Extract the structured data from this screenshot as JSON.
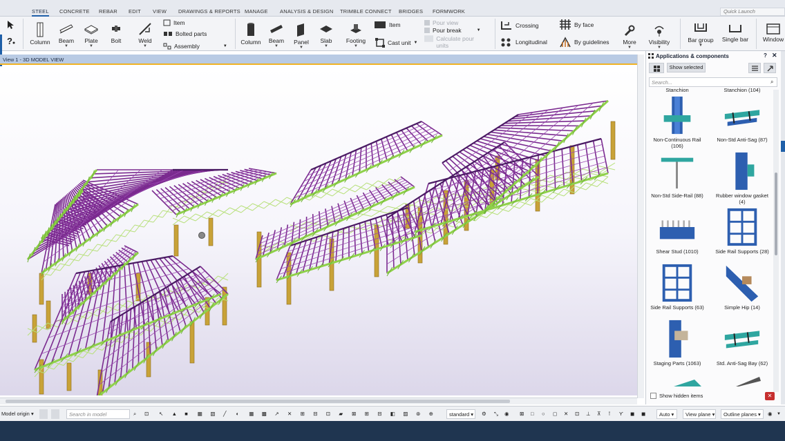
{
  "tabs": [
    "STEEL",
    "CONCRETE",
    "REBAR",
    "EDIT",
    "VIEW",
    "DRAWINGS & REPORTS",
    "MANAGE",
    "ANALYSIS & DESIGN",
    "TRIMBLE CONNECT",
    "BRIDGES",
    "FORMWORK"
  ],
  "quick_launch": "Quick Launch",
  "ribbon": {
    "steel": {
      "column": "Column",
      "beam": "Beam",
      "plate": "Plate",
      "bolt": "Bolt",
      "weld": "Weld",
      "item": "Item",
      "bolted_parts": "Bolted parts",
      "assembly": "Assembly"
    },
    "concrete": {
      "column": "Column",
      "beam": "Beam",
      "panel": "Panel",
      "slab": "Slab",
      "footing": "Footing",
      "item": "Item",
      "cast_unit": "Cast unit",
      "pour_view": "Pour view",
      "pour_break": "Pour break",
      "calculate_pour_units": "Calculate pour units"
    },
    "rebar": {
      "crossing": "Crossing",
      "longitudinal": "Longitudinal",
      "by_face": "By face",
      "by_guidelines": "By guidelines",
      "more": "More",
      "visibility": "Visibility",
      "bar_group": "Bar group",
      "single_bar": "Single bar",
      "window": "Window"
    }
  },
  "view": {
    "title": "View 1 - 3D MODEL VIEW"
  },
  "panel": {
    "title": "Applications & components",
    "show_selected": "Show selected",
    "search_placeholder": "Search...",
    "show_hidden": "Show hidden items",
    "components": [
      {
        "label": "Stanchion",
        "icon": "stanchion-icon"
      },
      {
        "label": "Stanchion (104)",
        "icon": "stanchion-icon"
      },
      {
        "label": "Non-Continuous Rail (106)",
        "icon": "non-continuous-rail-icon"
      },
      {
        "label": "Non-Std Anti-Sag (87)",
        "icon": "non-std-anti-sag-icon"
      },
      {
        "label": "Non-Std Side-Rail (88)",
        "icon": "non-std-side-rail-icon"
      },
      {
        "label": "Rubber window gasket (4)",
        "icon": "rubber-window-gasket-icon"
      },
      {
        "label": "Shear Stud (1010)",
        "icon": "shear-stud-icon"
      },
      {
        "label": "Side Rail Supports (28)",
        "icon": "side-rail-supports-icon"
      },
      {
        "label": "Side Rail Supports (63)",
        "icon": "side-rail-supports-icon"
      },
      {
        "label": "Simple Hip (14)",
        "icon": "simple-hip-icon"
      },
      {
        "label": "Staging Parts (1063)",
        "icon": "staging-parts-icon"
      },
      {
        "label": "Std. Anti-Sag Bay (62)",
        "icon": "std-anti-sag-bay-icon"
      }
    ]
  },
  "bottom": {
    "model_origin": "Model origin",
    "search_model": "Search in model",
    "standard": "standard",
    "auto": "Auto",
    "view_plane": "View plane",
    "outline_planes": "Outline planes"
  },
  "colors": {
    "accent": "#1f5fa8",
    "roof_members": "#7a2a8f",
    "bracing": "#8fd14a",
    "columns": "#c8a238",
    "view_tab": "#b9cbe4",
    "status_bar": "#1f3550"
  }
}
